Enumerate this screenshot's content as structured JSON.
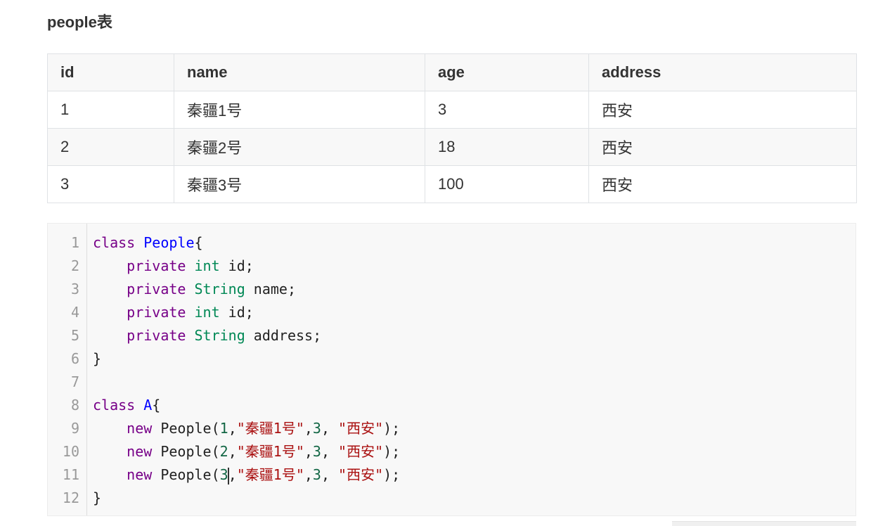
{
  "heading": "people表",
  "table": {
    "columns": [
      "id",
      "name",
      "age",
      "address"
    ],
    "rows": [
      [
        "1",
        "秦疆1号",
        "3",
        "西安"
      ],
      [
        "2",
        "秦疆2号",
        "18",
        "西安"
      ],
      [
        "3",
        "秦疆3号",
        "100",
        "西安"
      ]
    ]
  },
  "code": {
    "line_numbers": [
      "1",
      "2",
      "3",
      "4",
      "5",
      "6",
      "7",
      "8",
      "9",
      "10",
      "11",
      "12"
    ],
    "lines": [
      [
        {
          "t": "class ",
          "c": "kw"
        },
        {
          "t": "People",
          "c": "def"
        },
        {
          "t": "{",
          "c": "plain"
        }
      ],
      [
        {
          "t": "    ",
          "c": "plain"
        },
        {
          "t": "private ",
          "c": "kw"
        },
        {
          "t": "int ",
          "c": "var3"
        },
        {
          "t": "id;",
          "c": "plain"
        }
      ],
      [
        {
          "t": "    ",
          "c": "plain"
        },
        {
          "t": "private ",
          "c": "kw"
        },
        {
          "t": "String ",
          "c": "var3"
        },
        {
          "t": "name;",
          "c": "plain"
        }
      ],
      [
        {
          "t": "    ",
          "c": "plain"
        },
        {
          "t": "private ",
          "c": "kw"
        },
        {
          "t": "int ",
          "c": "var3"
        },
        {
          "t": "id;",
          "c": "plain"
        }
      ],
      [
        {
          "t": "    ",
          "c": "plain"
        },
        {
          "t": "private ",
          "c": "kw"
        },
        {
          "t": "String ",
          "c": "var3"
        },
        {
          "t": "address;",
          "c": "plain"
        }
      ],
      [
        {
          "t": "}",
          "c": "plain"
        }
      ],
      [],
      [
        {
          "t": "class ",
          "c": "kw"
        },
        {
          "t": "A",
          "c": "def"
        },
        {
          "t": "{",
          "c": "plain"
        }
      ],
      [
        {
          "t": "    ",
          "c": "plain"
        },
        {
          "t": "new ",
          "c": "kw"
        },
        {
          "t": "People(",
          "c": "plain"
        },
        {
          "t": "1",
          "c": "num"
        },
        {
          "t": ",",
          "c": "plain"
        },
        {
          "t": "\"秦疆1号\"",
          "c": "str"
        },
        {
          "t": ",",
          "c": "plain"
        },
        {
          "t": "3",
          "c": "num"
        },
        {
          "t": ", ",
          "c": "plain"
        },
        {
          "t": "\"西安\"",
          "c": "str"
        },
        {
          "t": ");",
          "c": "plain"
        }
      ],
      [
        {
          "t": "    ",
          "c": "plain"
        },
        {
          "t": "new ",
          "c": "kw"
        },
        {
          "t": "People(",
          "c": "plain"
        },
        {
          "t": "2",
          "c": "num"
        },
        {
          "t": ",",
          "c": "plain"
        },
        {
          "t": "\"秦疆1号\"",
          "c": "str"
        },
        {
          "t": ",",
          "c": "plain"
        },
        {
          "t": "3",
          "c": "num"
        },
        {
          "t": ", ",
          "c": "plain"
        },
        {
          "t": "\"西安\"",
          "c": "str"
        },
        {
          "t": ");",
          "c": "plain"
        }
      ],
      [
        {
          "t": "    ",
          "c": "plain"
        },
        {
          "t": "new ",
          "c": "kw"
        },
        {
          "t": "People(",
          "c": "plain"
        },
        {
          "t": "3",
          "c": "num"
        },
        {
          "t": "|",
          "c": "cursor"
        },
        {
          "t": ",",
          "c": "plain"
        },
        {
          "t": "\"秦疆1号\"",
          "c": "str"
        },
        {
          "t": ",",
          "c": "plain"
        },
        {
          "t": "3",
          "c": "num"
        },
        {
          "t": ", ",
          "c": "plain"
        },
        {
          "t": "\"西安\"",
          "c": "str"
        },
        {
          "t": ");",
          "c": "plain"
        }
      ],
      [
        {
          "t": "}",
          "c": "plain"
        }
      ]
    ]
  },
  "colors": {
    "keyword": "#770088",
    "definition": "#0000ff",
    "type": "#008855",
    "number": "#116644",
    "string": "#aa1111",
    "code_background": "#f8f8f8",
    "table_border": "#dfe2e5"
  }
}
